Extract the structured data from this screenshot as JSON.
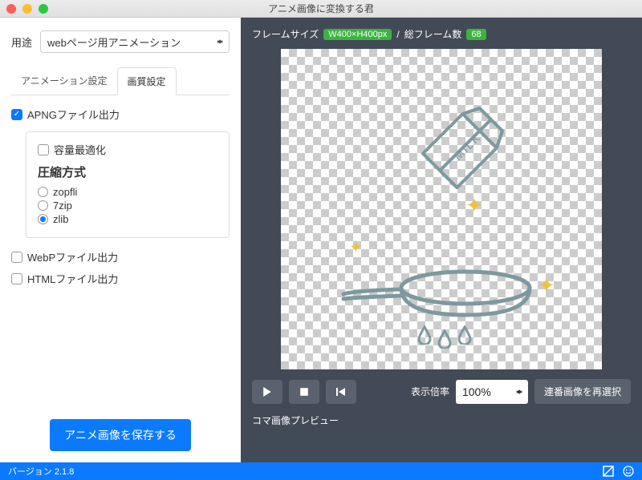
{
  "window": {
    "title": "アニメ画像に変換する君"
  },
  "left": {
    "purpose_label": "用途",
    "purpose_value": "webページ用アニメーション",
    "tabs": {
      "anim": "アニメーション設定",
      "quality": "画質設定"
    },
    "apng_output": "APNGファイル出力",
    "optimize": "容量最適化",
    "compression_heading": "圧縮方式",
    "compression": {
      "zopfli": "zopfli",
      "sevenzip": "7zip",
      "zlib": "zlib"
    },
    "webp_output": "WebPファイル出力",
    "html_output": "HTMLファイル出力",
    "save_button": "アニメ画像を保存する"
  },
  "right": {
    "frame_size_label": "フレームサイズ",
    "frame_size_value": "W400×H400px",
    "frame_count_label": "総フレーム数",
    "frame_count_value": "68",
    "zoom_label": "表示倍率",
    "zoom_value": "100%",
    "reselect": "連番画像を再選択",
    "preview_label": "コマ画像プレビュー"
  },
  "statusbar": {
    "version": "バージョン 2.1.8"
  },
  "colors": {
    "accent": "#0b7aff",
    "badge": "#3cb341",
    "right_bg": "#424a55"
  }
}
